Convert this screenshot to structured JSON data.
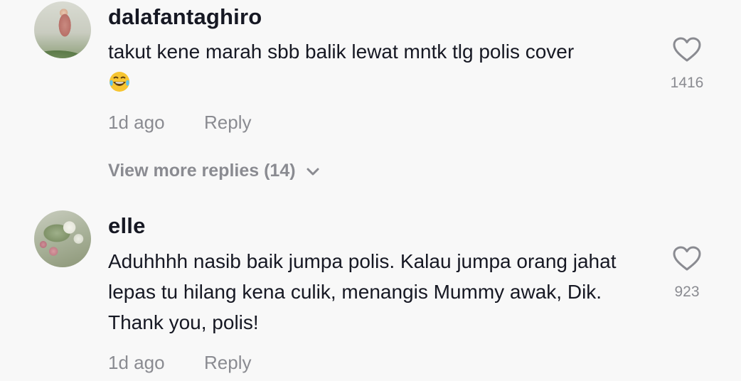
{
  "comments": [
    {
      "username": "dalafantaghiro",
      "text": "takut kene marah sbb balik lewat mntk tlg polis cover",
      "emoji": "tears-of-joy-emoji",
      "likes": "1416",
      "time": "1d ago",
      "reply_label": "Reply"
    },
    {
      "username": "elle",
      "text": "Aduhhhh nasib baik jumpa polis. Kalau jumpa orang jahat lepas tu hilang kena culik, menangis Mummy awak, Dik. Thank you, polis!",
      "likes": "923",
      "time": "1d ago",
      "reply_label": "Reply"
    }
  ],
  "view_more": {
    "label": "View more replies (14)",
    "icon": "chevron-down-icon"
  },
  "colors": {
    "background": "#f8f8f8",
    "primary_text": "#161823",
    "secondary_text": "#8a8b91"
  }
}
